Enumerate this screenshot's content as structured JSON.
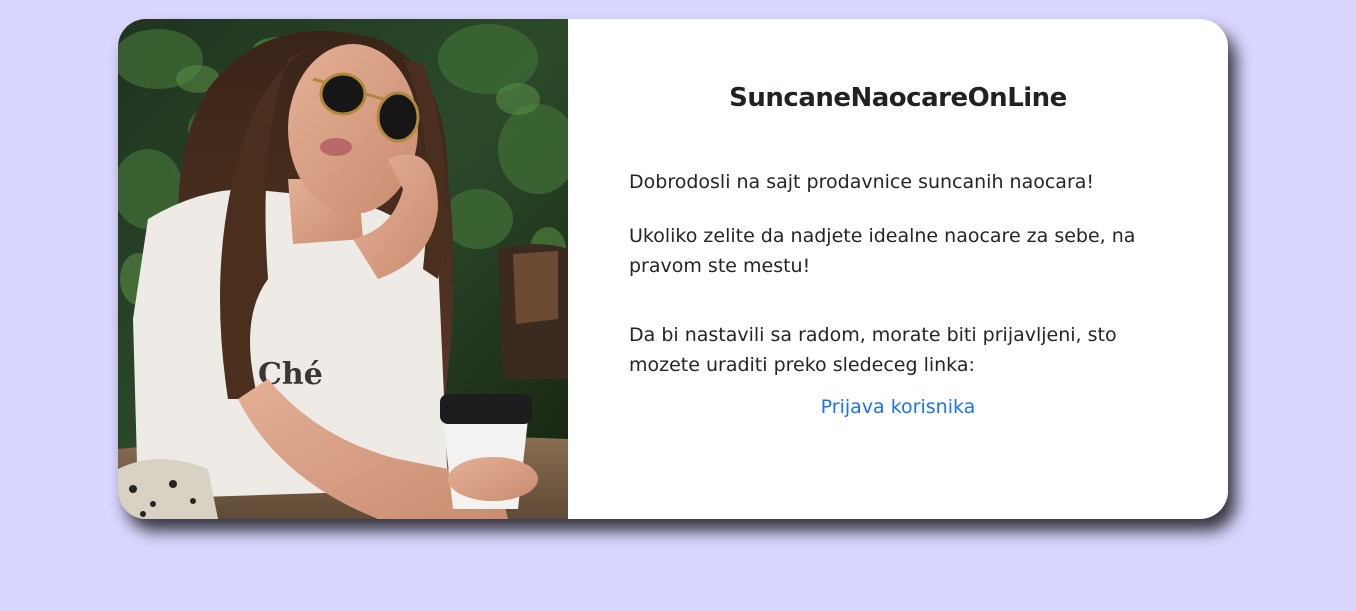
{
  "card": {
    "title": "SuncaneNaocareOnLine",
    "welcome": "Dobrodosli na sajt prodavnice suncanih naocara!",
    "intro": "Ukoliko zelite da nadjete idealne naocare za sebe, na pravom ste mestu!",
    "login_prompt": "Da bi nastavili sa radom, morate biti prijavljeni, sto mozete uraditi preko sledeceg linka:",
    "login_link": "Prijava korisnika",
    "photo_text": "Ché"
  },
  "colors": {
    "background": "#d9d7ff",
    "card": "#ffffff",
    "link": "#1a73e8"
  }
}
